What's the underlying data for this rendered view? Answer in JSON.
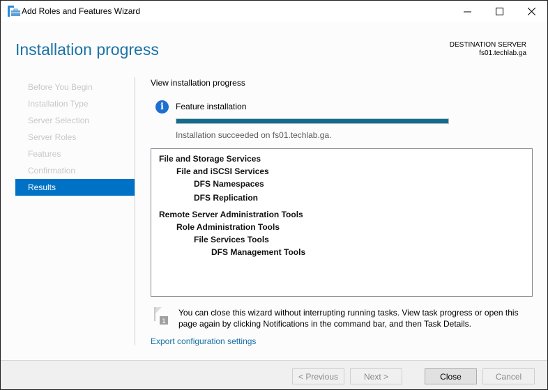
{
  "window": {
    "title": "Add Roles and Features Wizard",
    "app_icon": "server-manager-wizard-icon",
    "controls": [
      "minimize-icon",
      "maximize-icon",
      "close-icon"
    ]
  },
  "header": {
    "page_title": "Installation progress",
    "destination_label": "DESTINATION SERVER",
    "destination_server": "fs01.techlab.ga"
  },
  "nav": {
    "items": [
      {
        "label": "Before You Begin",
        "active": false
      },
      {
        "label": "Installation Type",
        "active": false
      },
      {
        "label": "Server Selection",
        "active": false
      },
      {
        "label": "Server Roles",
        "active": false
      },
      {
        "label": "Features",
        "active": false
      },
      {
        "label": "Confirmation",
        "active": false
      },
      {
        "label": "Results",
        "active": true
      }
    ]
  },
  "main": {
    "section_label": "View installation progress",
    "feature_label": "Feature installation",
    "info_icon": "info-icon",
    "progress_percent": 100,
    "status_text": "Installation succeeded on fs01.techlab.ga.",
    "results": [
      {
        "label": "File and Storage Services",
        "level": 0
      },
      {
        "label": "File and iSCSI Services",
        "level": 1
      },
      {
        "label": "DFS Namespaces",
        "level": 2
      },
      {
        "label": "DFS Replication",
        "level": 2
      },
      {
        "label": "Remote Server Administration Tools",
        "level": 0
      },
      {
        "label": "Role Administration Tools",
        "level": 1
      },
      {
        "label": "File Services Tools",
        "level": 2
      },
      {
        "label": "DFS Management Tools",
        "level": 3
      }
    ],
    "note_badge": "1",
    "note_text": "You can close this wizard without interrupting running tasks. View task progress or open this page again by clicking Notifications in the command bar, and then Task Details.",
    "export_link": "Export configuration settings"
  },
  "footer": {
    "previous_label": "< Previous",
    "next_label": "Next >",
    "close_label": "Close",
    "cancel_label": "Cancel"
  },
  "colors": {
    "accent": "#0072c6",
    "title_blue": "#1a73a6",
    "progress": "#0f6e8f"
  }
}
